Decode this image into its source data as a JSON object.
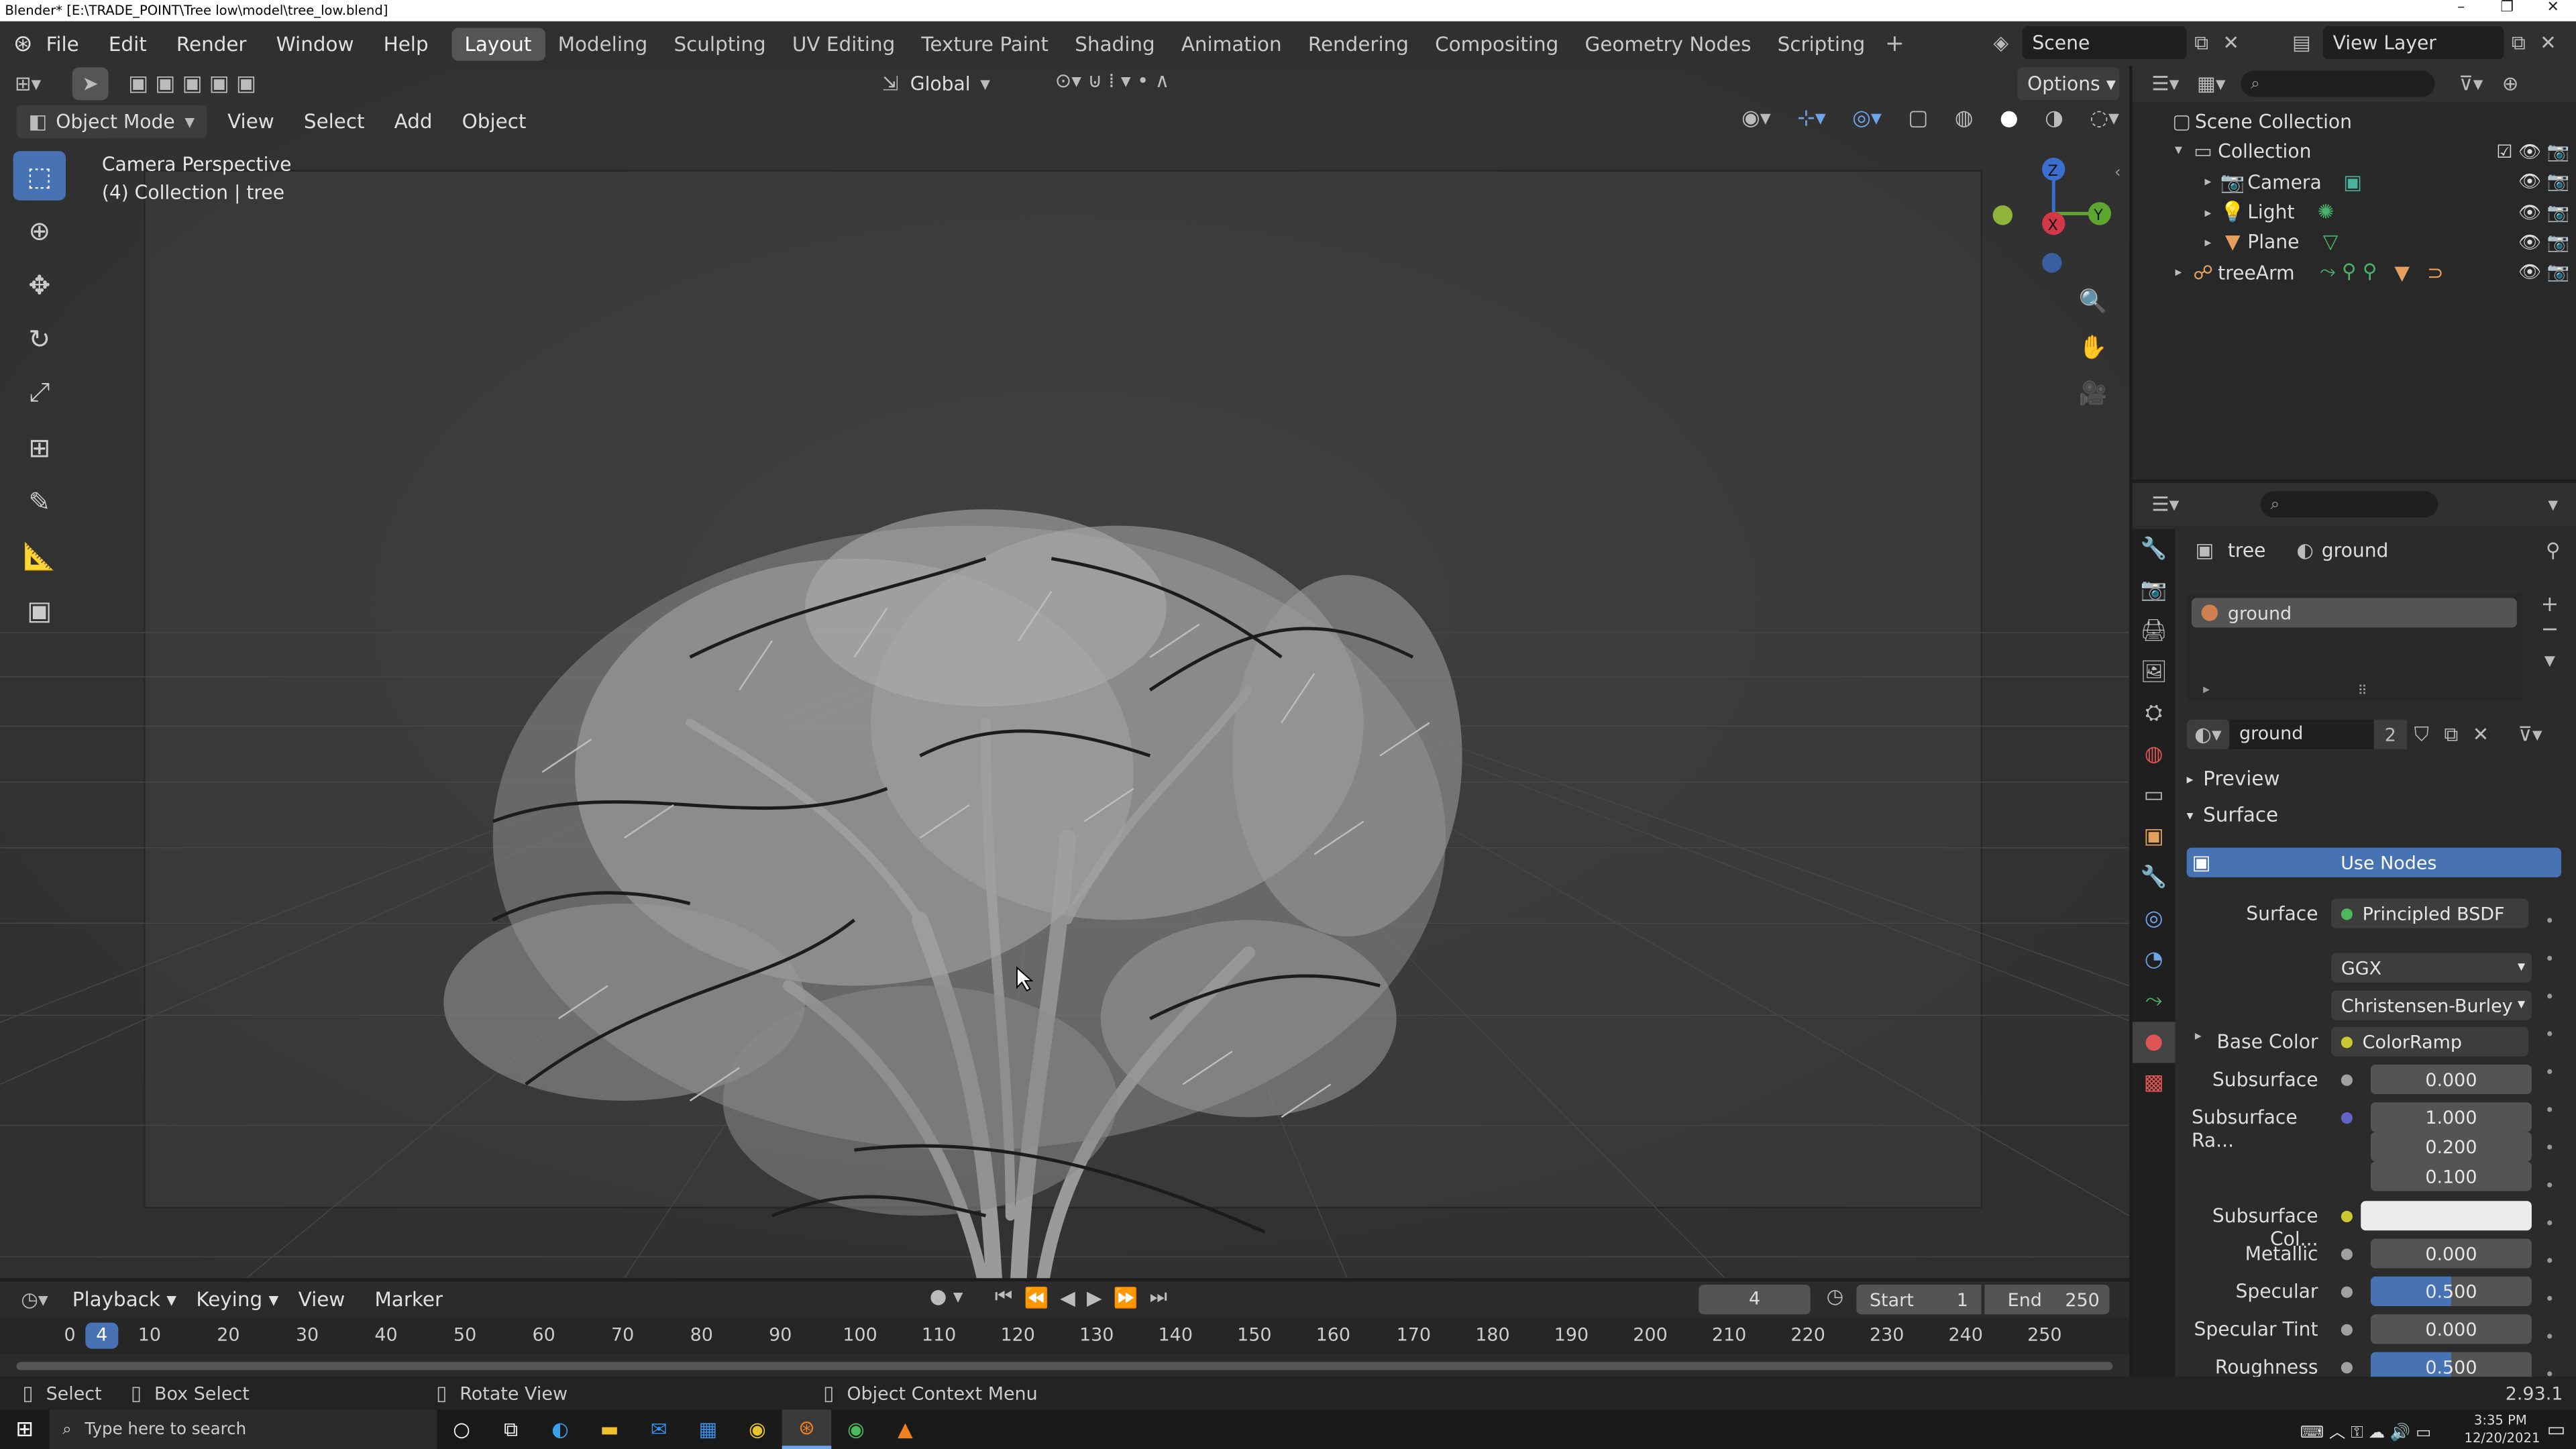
{
  "title": "Blender* [E:\\TRADE_POINT\\Tree low\\model\\tree_low.blend]",
  "menus": [
    "File",
    "Edit",
    "Render",
    "Window",
    "Help"
  ],
  "workspaces": [
    "Layout",
    "Modeling",
    "Sculpting",
    "UV Editing",
    "Texture Paint",
    "Shading",
    "Animation",
    "Rendering",
    "Compositing",
    "Geometry Nodes",
    "Scripting"
  ],
  "scene": "Scene",
  "view_layer": "View Layer",
  "viewport": {
    "mode": "Object Mode",
    "menus": [
      "View",
      "Select",
      "Add",
      "Object"
    ],
    "transform": "Global",
    "options": "Options",
    "camera_label": "Camera Perspective",
    "collection_label": "(4) Collection | tree"
  },
  "gizmo": {
    "x": "X",
    "y": "Y",
    "z": "Z"
  },
  "outliner": {
    "root": "Scene Collection",
    "collection": "Collection",
    "items": [
      "Camera",
      "Light",
      "Plane",
      "treeArm"
    ]
  },
  "props": {
    "breadcrumb_obj": "tree",
    "breadcrumb_mat": "ground",
    "slot": "ground",
    "mat_name": "ground",
    "users": "2",
    "preview": "Preview",
    "surface_panel": "Surface",
    "use_nodes": "Use Nodes",
    "rows": [
      {
        "label": "Surface",
        "value": "Principled BSDF",
        "color": "#4bba5a"
      },
      {
        "label": "",
        "value": "GGX"
      },
      {
        "label": "",
        "value": "Christensen-Burley"
      },
      {
        "label": "Base Color",
        "value": "ColorRamp",
        "color": "#c8c830"
      },
      {
        "label": "Subsurface",
        "value": "0.000",
        "color": "#a0a0a0"
      },
      {
        "label": "Subsurface Ra...",
        "value": "1.000",
        "color": "#6363c7"
      },
      {
        "label": "",
        "value": "0.200"
      },
      {
        "label": "",
        "value": "0.100"
      },
      {
        "label": "Subsurface Col...",
        "value": "",
        "color": "#c8c830"
      },
      {
        "label": "Metallic",
        "value": "0.000",
        "color": "#a0a0a0"
      },
      {
        "label": "Specular",
        "value": "0.500",
        "color": "#a0a0a0"
      },
      {
        "label": "Specular Tint",
        "value": "0.000",
        "color": "#a0a0a0"
      },
      {
        "label": "Roughness",
        "value": "0.500",
        "color": "#a0a0a0"
      }
    ]
  },
  "timeline": {
    "menus": [
      "Playback",
      "Keying",
      "View",
      "Marker"
    ],
    "frame": "4",
    "start_label": "Start",
    "start": "1",
    "end_label": "End",
    "end": "250",
    "ticks": [
      "0",
      "4",
      "10",
      "20",
      "30",
      "40",
      "50",
      "60",
      "70",
      "80",
      "90",
      "100",
      "110",
      "120",
      "130",
      "140",
      "150",
      "160",
      "170",
      "180",
      "190",
      "200",
      "210",
      "220",
      "230",
      "240",
      "250"
    ]
  },
  "status": {
    "select": "Select",
    "box": "Box Select",
    "rotate": "Rotate View",
    "context": "Object Context Menu",
    "version": "2.93.1"
  },
  "taskbar": {
    "search": "Type here to search",
    "time": "3:35 PM",
    "date": "12/20/2021"
  }
}
